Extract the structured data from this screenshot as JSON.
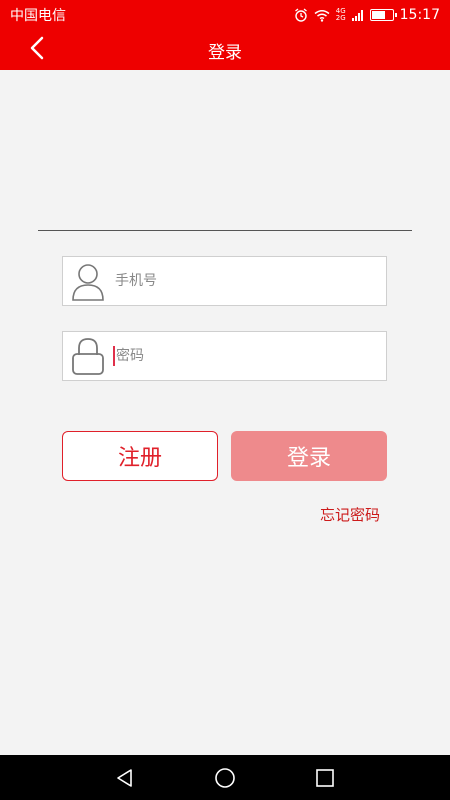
{
  "status_bar": {
    "carrier": "中国电信",
    "time": "15:17",
    "network_top": "4G",
    "network_bottom": "2G",
    "icons": [
      "alarm-icon",
      "wifi-icon",
      "signal-icon",
      "battery-icon"
    ]
  },
  "app_bar": {
    "title": "登录",
    "back_icon": "chevron-left-icon"
  },
  "form": {
    "phone": {
      "placeholder": "手机号",
      "value": "",
      "icon": "user-icon"
    },
    "password": {
      "placeholder": "密码",
      "value": "",
      "icon": "lock-icon"
    }
  },
  "actions": {
    "register_label": "注册",
    "login_label": "登录",
    "forgot_label": "忘记密码"
  },
  "nav": {
    "icons": [
      "back-triangle-icon",
      "home-circle-icon",
      "recents-square-icon"
    ]
  },
  "colors": {
    "primary": "#ee0000",
    "login_disabled": "#ee8a8c",
    "register_border": "#e0202a",
    "forgot_text": "#cc1a1a",
    "background": "#f3f3f3"
  }
}
